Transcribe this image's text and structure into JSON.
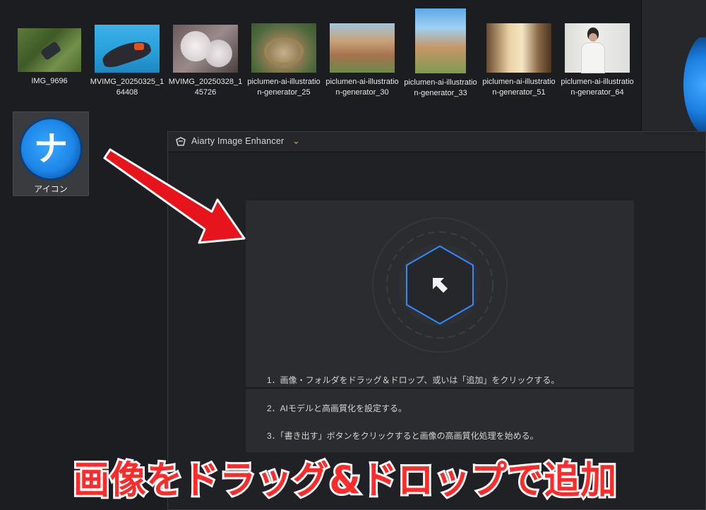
{
  "files": [
    {
      "name": "IMG_9696",
      "icon": "image-thumbnail"
    },
    {
      "name": "MVIMG_20250325_164408",
      "icon": "image-thumbnail"
    },
    {
      "name": "MVIMG_20250328_145726",
      "icon": "image-thumbnail"
    },
    {
      "name": "piclumen-ai-illustration-generator_25",
      "icon": "image-thumbnail"
    },
    {
      "name": "piclumen-ai-illustration-generator_30",
      "icon": "image-thumbnail"
    },
    {
      "name": "piclumen-ai-illustration-generator_33",
      "icon": "image-thumbnail"
    },
    {
      "name": "piclumen-ai-illustration-generator_51",
      "icon": "image-thumbnail"
    },
    {
      "name": "piclumen-ai-illustration-generator_64",
      "icon": "image-thumbnail"
    }
  ],
  "selected_file": {
    "name": "アイコン",
    "glyph": "ナ",
    "icon": "app-icon"
  },
  "app": {
    "title": "Aiarty Image Enhancer",
    "menu_icon": "chevron-down-icon",
    "drop_icon": "upload-arrow-icon",
    "steps": [
      "1．画像・フォルダをドラッグ＆ドロップ、或いは「追加」をクリックする。",
      "2．AIモデルと高画質化を設定する。",
      "3．「書き出す」ボタンをクリックすると画像の高画質化処理を始める。"
    ]
  },
  "annotation": {
    "caption": "画像をドラッグ&ドロップで追加",
    "caption_color": "#ff2a2a",
    "arrow_color": "#e8141c"
  },
  "colors": {
    "accent": "#2f8cff",
    "background": "#1c1d20"
  }
}
